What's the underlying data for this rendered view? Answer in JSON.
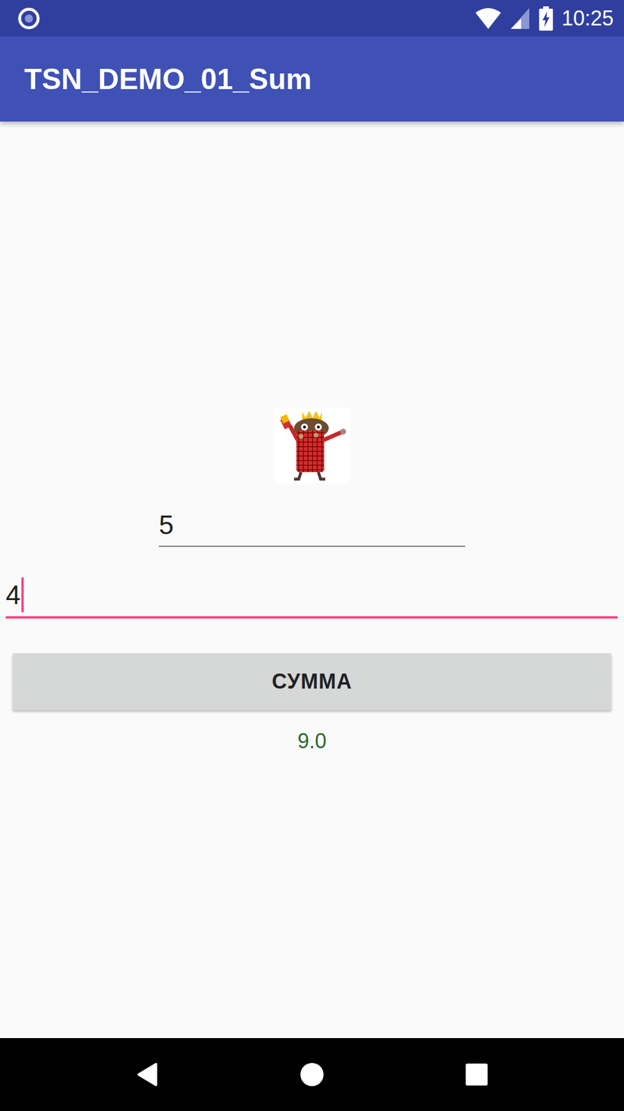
{
  "status_bar": {
    "time": "10:25"
  },
  "app_bar": {
    "title": "TSN_DEMO_01_Sum"
  },
  "fields": [
    {
      "value": "5",
      "focused": false
    },
    {
      "value": "4",
      "focused": true
    }
  ],
  "button": {
    "label": "СУММА"
  },
  "result": "9.0"
}
